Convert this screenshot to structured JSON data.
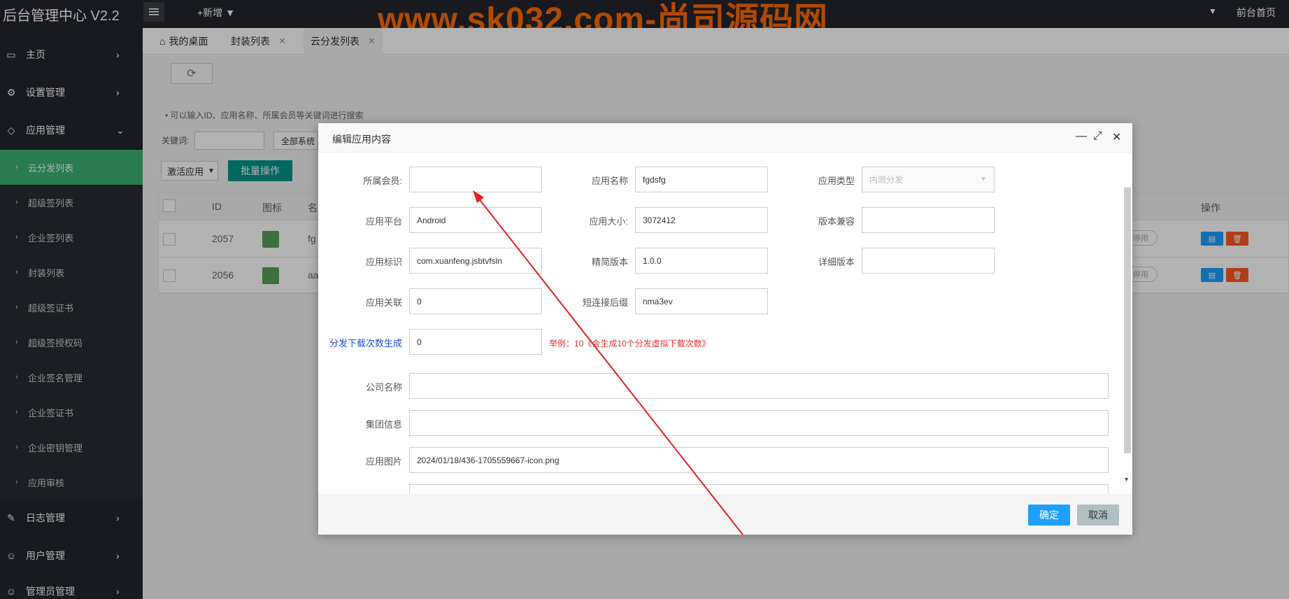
{
  "app": {
    "title": "后台管理中心 V2.2",
    "new_label": "+新增",
    "home_label": "前台首页",
    "watermark": "www.sk032.com-尚司源码网"
  },
  "sidebar": {
    "items": [
      {
        "label": "主页",
        "icon": "monitor-icon"
      },
      {
        "label": "设置管理",
        "icon": "gear-icon"
      },
      {
        "label": "应用管理",
        "icon": "tag-icon"
      },
      {
        "label": "日志管理",
        "icon": "edit-icon"
      },
      {
        "label": "用户管理",
        "icon": "user-icon"
      },
      {
        "label": "管理员管理",
        "icon": "user-icon"
      }
    ],
    "subitems": [
      {
        "label": "云分发列表",
        "active": true
      },
      {
        "label": "超级签列表"
      },
      {
        "label": "企业签列表"
      },
      {
        "label": "封装列表"
      },
      {
        "label": "超级签证书"
      },
      {
        "label": "超级签授权码"
      },
      {
        "label": "企业签名管理"
      },
      {
        "label": "企业签证书"
      },
      {
        "label": "企业密钥管理"
      },
      {
        "label": "应用审核"
      }
    ]
  },
  "tabs": [
    {
      "label": "我的桌面"
    },
    {
      "label": "封装列表"
    },
    {
      "label": "云分发列表",
      "active": true
    }
  ],
  "main": {
    "hint": "• 可以输入ID、应用名称、所属会员等关键词进行搜索",
    "keyword_label": "关键词:",
    "system_select": "全部系统",
    "activate_select": "激活应用",
    "batch_label": "批量操作",
    "columns": [
      "ID",
      "图标",
      "名",
      "操作"
    ],
    "rows": [
      {
        "id": "2057",
        "name": "fg",
        "status": "停用"
      },
      {
        "id": "2056",
        "name": "aa",
        "status": "停用"
      }
    ]
  },
  "modal": {
    "title": "编辑应用内容",
    "fields": {
      "member_label": "所属会员:",
      "member_value": "",
      "name_label": "应用名称",
      "name_value": "fgdsfg",
      "type_label": "应用类型",
      "type_value": "内测分发",
      "platform_label": "应用平台",
      "platform_value": "Android",
      "size_label": "应用大小:",
      "size_value": "3072412",
      "compat_label": "版本兼容",
      "compat_value": "",
      "bundle_label": "应用标识",
      "bundle_value": "com.xuanfeng.jsbtvfsln",
      "short_ver_label": "精简版本",
      "short_ver_value": "1.0.0",
      "detail_ver_label": "详细版本",
      "detail_ver_value": "",
      "assoc_label": "应用关联",
      "assoc_value": "0",
      "short_link_label": "短连接后缀",
      "short_link_value": "nma3ev",
      "downloads_label": "分发下载次数生成",
      "downloads_value": "0",
      "downloads_example": "举例：10《会生成10个分发虚拟下载次数》",
      "company_label": "公司名称",
      "company_value": "",
      "group_label": "集团信息",
      "group_value": "",
      "image_label": "应用图片",
      "image_value": "2024/01/18/436-1705559667-icon.png"
    },
    "ok_label": "确定",
    "cancel_label": "取消"
  },
  "colors": {
    "sidebar_bg": "#23262e",
    "active_green": "#3cb371",
    "batch_teal": "#009688",
    "ok_blue": "#1e9fff",
    "arrow_red": "#e82020",
    "watermark_orange": "#ff6a00"
  }
}
